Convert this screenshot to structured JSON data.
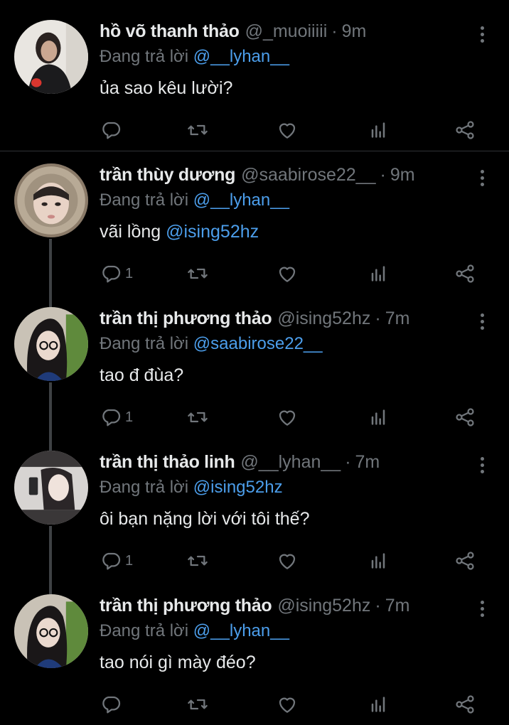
{
  "reply_prefix": "Đang trả lời",
  "icons": {
    "reply": "reply-bubble-icon",
    "retweet": "retweet-icon",
    "like": "heart-icon",
    "stats": "bar-chart-icon",
    "share": "share-icon",
    "more": "more-vertical-icon"
  },
  "colors": {
    "background": "#000000",
    "text": "#e7e9ea",
    "muted": "#71767b",
    "link": "#4c9eeb",
    "thread": "#3e4144"
  },
  "tweets": [
    {
      "name": "hồ võ thanh thảo",
      "handle": "@_muoiiiii",
      "dot": "·",
      "time": "9m",
      "reply_to": "@__lyhan__",
      "text": "ủa sao kêu lười?",
      "mention": "",
      "reply_count": ""
    },
    {
      "name": "trần thùy dương",
      "handle": "@saabirose22__",
      "dot": "·",
      "time": "9m",
      "reply_to": "@__lyhan__",
      "text": "vãi lồng ",
      "mention": "@ising52hz",
      "reply_count": "1"
    },
    {
      "name": "trần thị phương thảo",
      "handle": "@ising52hz",
      "dot": "·",
      "time": "7m",
      "reply_to": "@saabirose22__",
      "text": "tao đ đùa?",
      "mention": "",
      "reply_count": "1"
    },
    {
      "name": "trần thị thảo linh",
      "handle": "@__lyhan__",
      "dot": "·",
      "time": "7m",
      "reply_to": "@ising52hz",
      "text": "ôi bạn nặng lời với tôi thế?",
      "mention": "",
      "reply_count": "1"
    },
    {
      "name": "trần thị phương thảo",
      "handle": "@ising52hz",
      "dot": "·",
      "time": "7m",
      "reply_to": "@__lyhan__",
      "text": "tao nói gì mày đéo?",
      "mention": "",
      "reply_count": ""
    }
  ]
}
